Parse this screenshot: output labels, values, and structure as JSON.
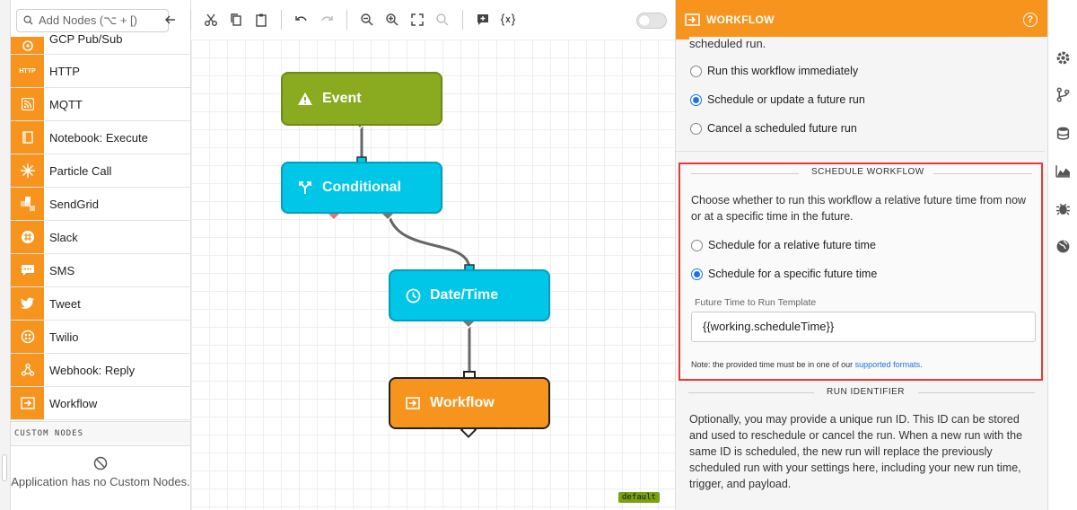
{
  "search": {
    "placeholder": "Add Nodes (⌥ + [)"
  },
  "sidebar": {
    "items": [
      {
        "label": "GCP Pub/Sub",
        "icon": "gcp-icon",
        "badge": ""
      },
      {
        "label": "HTTP",
        "icon": "http-icon",
        "badge": "HTTP"
      },
      {
        "label": "MQTT",
        "icon": "rss-icon",
        "badge": ""
      },
      {
        "label": "Notebook: Execute",
        "icon": "notebook-icon",
        "badge": ""
      },
      {
        "label": "Particle Call",
        "icon": "particle-icon",
        "badge": ""
      },
      {
        "label": "SendGrid",
        "icon": "sendgrid-icon",
        "badge": ""
      },
      {
        "label": "Slack",
        "icon": "slack-icon",
        "badge": ""
      },
      {
        "label": "SMS",
        "icon": "sms-icon",
        "badge": ""
      },
      {
        "label": "Tweet",
        "icon": "twitter-icon",
        "badge": ""
      },
      {
        "label": "Twilio",
        "icon": "twilio-icon",
        "badge": ""
      },
      {
        "label": "Webhook: Reply",
        "icon": "webhook-icon",
        "badge": ""
      },
      {
        "label": "Workflow",
        "icon": "workflow-icon",
        "badge": ""
      }
    ],
    "custom_title": "CUSTOM NODES",
    "custom_empty": "Application has no Custom Nodes."
  },
  "canvas": {
    "nodes": {
      "event": "Event",
      "conditional": "Conditional",
      "datetime": "Date/Time",
      "workflow": "Workflow"
    },
    "tag": "default"
  },
  "panel": {
    "title": "WORKFLOW",
    "help": "?",
    "intro_tail": "scheduled run.",
    "action_options": [
      {
        "label": "Run this workflow immediately",
        "selected": false
      },
      {
        "label": "Schedule or update a future run",
        "selected": true
      },
      {
        "label": "Cancel a scheduled future run",
        "selected": false
      }
    ],
    "schedule": {
      "title": "SCHEDULE WORKFLOW",
      "description": "Choose whether to run this workflow a relative future time from now or at a specific time in the future.",
      "options": [
        {
          "label": "Schedule for a relative future time",
          "selected": false
        },
        {
          "label": "Schedule for a specific future time",
          "selected": true
        }
      ],
      "field_label": "Future Time to Run Template",
      "field_value": "{{working.scheduleTime}}",
      "note_prefix": "Note: the provided time must be in one of our ",
      "note_link": "supported formats",
      "note_suffix": "."
    },
    "run_identifier": {
      "title": "RUN IDENTIFIER",
      "description": "Optionally, you may provide a unique run ID. This ID can be stored and used to reschedule or cancel the run. When a new run with the same ID is scheduled, the new run will replace the previously scheduled run with your settings here, including your new run time, trigger, and payload."
    }
  },
  "colors": {
    "accent": "#f7941d",
    "event": "#8aaa1f",
    "cyan": "#00c6e8",
    "highlight": "#e53935",
    "link": "#1a73e8"
  }
}
